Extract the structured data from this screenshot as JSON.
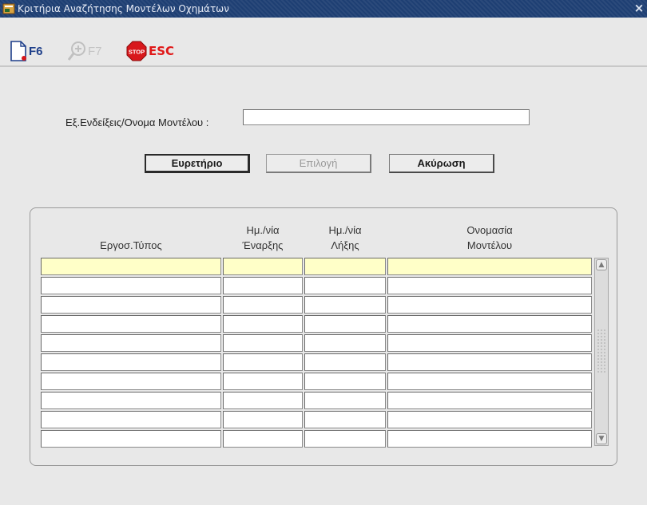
{
  "window": {
    "title": "Κριτήρια Αναζήτησης Μοντέλων Οχημάτων",
    "close_glyph": "×"
  },
  "toolbar": {
    "new_label": "F6",
    "query_label": "F7",
    "stop_label": "STOP",
    "exit_label": "ESC"
  },
  "form": {
    "model_field_label": "Εξ.Ενδείξεις/Ονομα Μοντέλου :",
    "model_field_value": ""
  },
  "buttons": {
    "index_label": "Ευρετήριο",
    "select_label": "Επιλογή",
    "cancel_label": "Ακύρωση"
  },
  "table": {
    "headers": [
      {
        "line1": "",
        "line2": "Εργοσ.Τύπος"
      },
      {
        "line1": "Ημ./νία",
        "line2": "Έναρξης"
      },
      {
        "line1": "Ημ./νία",
        "line2": "Λήξης"
      },
      {
        "line1": "Ονομασία",
        "line2": "Μοντέλου"
      }
    ],
    "row_count": 10,
    "rows": [
      [
        "",
        "",
        "",
        ""
      ],
      [
        "",
        "",
        "",
        ""
      ],
      [
        "",
        "",
        "",
        ""
      ],
      [
        "",
        "",
        "",
        ""
      ],
      [
        "",
        "",
        "",
        ""
      ],
      [
        "",
        "",
        "",
        ""
      ],
      [
        "",
        "",
        "",
        ""
      ],
      [
        "",
        "",
        "",
        ""
      ],
      [
        "",
        "",
        "",
        ""
      ],
      [
        "",
        "",
        "",
        ""
      ]
    ]
  },
  "colors": {
    "titlebar": "#1e3f73",
    "current_row": "#ffffc8",
    "stop_red": "#d8181c",
    "window_bg": "#e8e8e8"
  }
}
